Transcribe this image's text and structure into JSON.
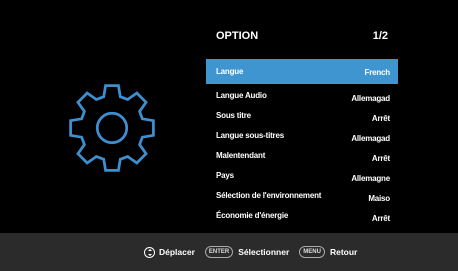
{
  "header": {
    "title": "OPTION",
    "page": "1/2"
  },
  "menu": {
    "items": [
      {
        "label": "Langue",
        "value": "French",
        "selected": true
      },
      {
        "label": "Langue Audio",
        "value": "Allemagad"
      },
      {
        "label": "Sous titre",
        "value": "Arrêt"
      },
      {
        "label": "Langue sous-titres",
        "value": "Allemagad"
      },
      {
        "label": "Malentendant",
        "value": "Arrêt"
      },
      {
        "label": "Pays",
        "value": "Allemagne"
      },
      {
        "label": "Sélection de l'environnement",
        "value": "Maiso"
      },
      {
        "label": "Économie d'énergie",
        "value": "Arrêt"
      }
    ]
  },
  "footer": {
    "move_label": "Déplacer",
    "enter_key": "ENTER",
    "select_label": "Sélectionner",
    "menu_key": "MENU",
    "back_label": "Retour"
  },
  "icons": {
    "settings": "gear-icon",
    "navigate": "navigation-arrows-icon"
  },
  "colors": {
    "highlight": "#3e95cf",
    "gear": "#3e8fd0",
    "background": "#000000",
    "footer_bg": "#2b2b2b"
  }
}
